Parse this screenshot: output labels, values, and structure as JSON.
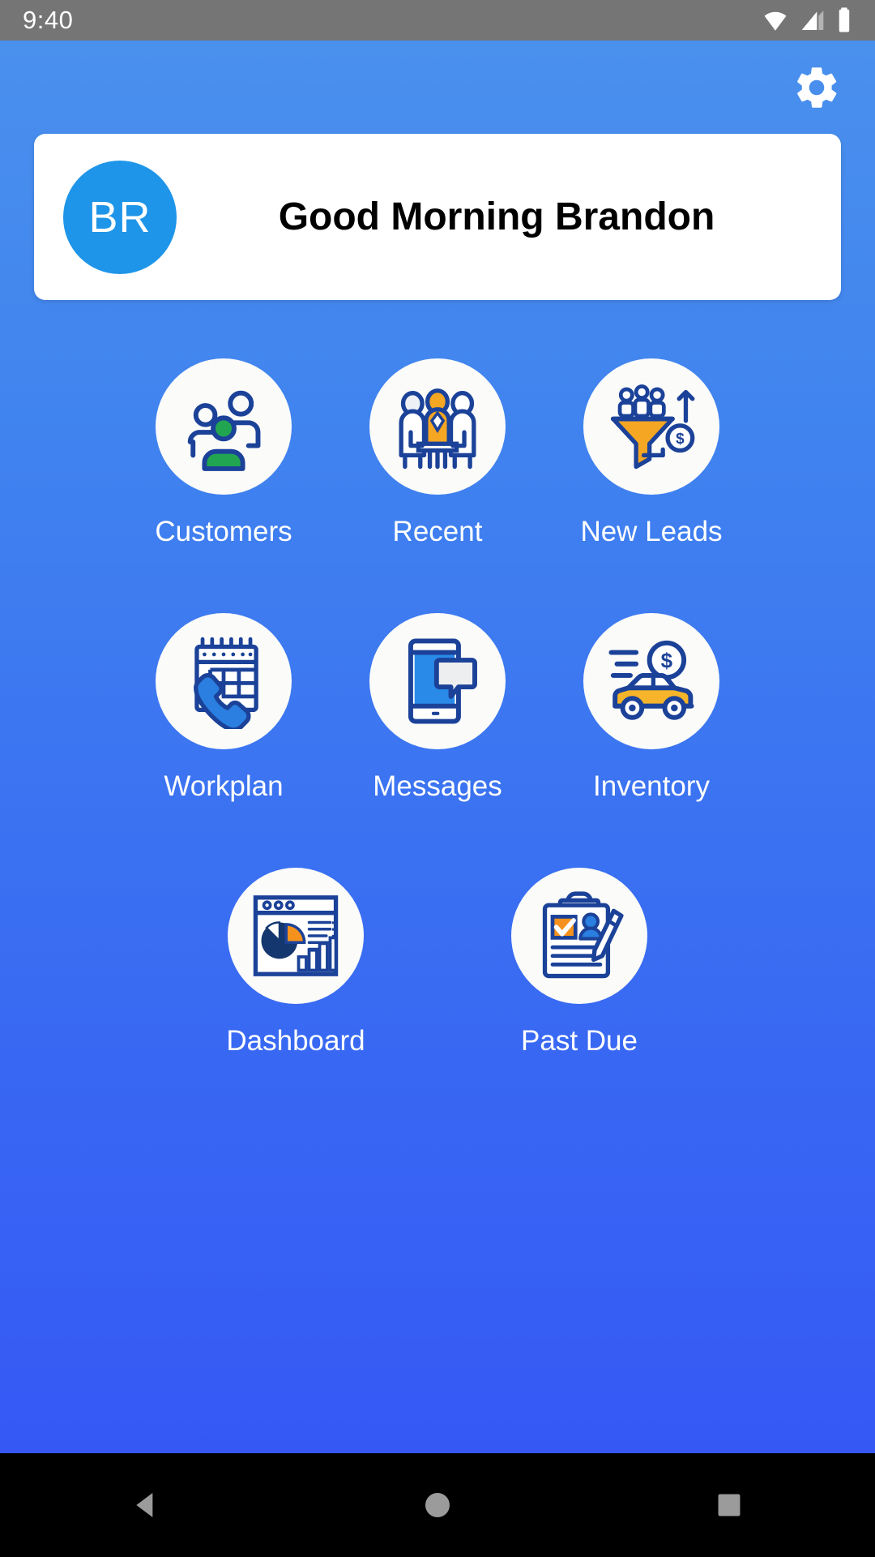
{
  "status_bar": {
    "time": "9:40",
    "icons": [
      "wifi-icon",
      "cellular-signal-icon",
      "battery-icon"
    ]
  },
  "header": {
    "settings_icon": "gear-icon",
    "avatar_initials": "BR",
    "greeting": "Good Morning Brandon"
  },
  "colors": {
    "bg_top": "#4a90ed",
    "bg_bottom": "#3558f5",
    "status_bar": "#757575",
    "card_bg": "#ffffff",
    "avatar_blue": "#1e95e8",
    "icon_navy": "#1b4298",
    "icon_orange": "#f5a623",
    "icon_green": "#22a551",
    "icon_light_blue": "#2a7fe0",
    "nav_bg": "#000000",
    "label_text": "#ffffff"
  },
  "grid": {
    "rows": [
      [
        {
          "label": "Customers",
          "icon": "people-group-icon"
        },
        {
          "label": "Recent",
          "icon": "meeting-table-icon"
        },
        {
          "label": "New Leads",
          "icon": "sales-funnel-icon"
        }
      ],
      [
        {
          "label": "Workplan",
          "icon": "calendar-phone-icon"
        },
        {
          "label": "Messages",
          "icon": "phone-chat-bubble-icon"
        },
        {
          "label": "Inventory",
          "icon": "car-dollar-icon"
        }
      ],
      [
        {
          "label": "Dashboard",
          "icon": "analytics-window-icon"
        },
        {
          "label": "Past Due",
          "icon": "clipboard-pen-icon"
        }
      ]
    ]
  },
  "navigation_bar": {
    "back": "back-triangle-icon",
    "home": "home-circle-icon",
    "recents": "recents-square-icon"
  }
}
